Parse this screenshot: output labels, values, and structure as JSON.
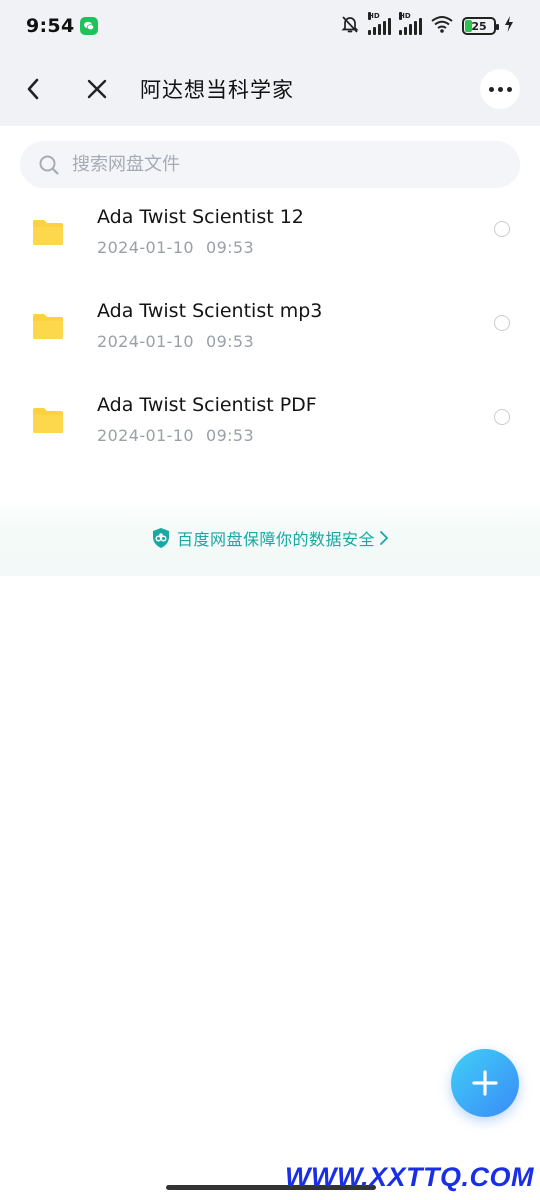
{
  "status_bar": {
    "time": "9:54",
    "battery_level": "25",
    "signal_label": "HD"
  },
  "header": {
    "title": "阿达想当科学家"
  },
  "search": {
    "placeholder": "搜索网盘文件"
  },
  "files": [
    {
      "name": "Ada Twist Scientist 12",
      "date": "2024-01-10",
      "time": "09:53"
    },
    {
      "name": "Ada Twist Scientist mp3",
      "date": "2024-01-10",
      "time": "09:53"
    },
    {
      "name": "Ada Twist Scientist PDF",
      "date": "2024-01-10",
      "time": "09:53"
    }
  ],
  "security_banner": {
    "text": "百度网盘保障你的数据安全"
  },
  "watermark": "WWW.XXTTQ.COM",
  "colors": {
    "folder": "#fdd13f",
    "accent_teal": "#19a8a4",
    "fab_start": "#3fd0f7",
    "fab_end": "#3b8af7",
    "header_bg": "#f1f2f6"
  }
}
